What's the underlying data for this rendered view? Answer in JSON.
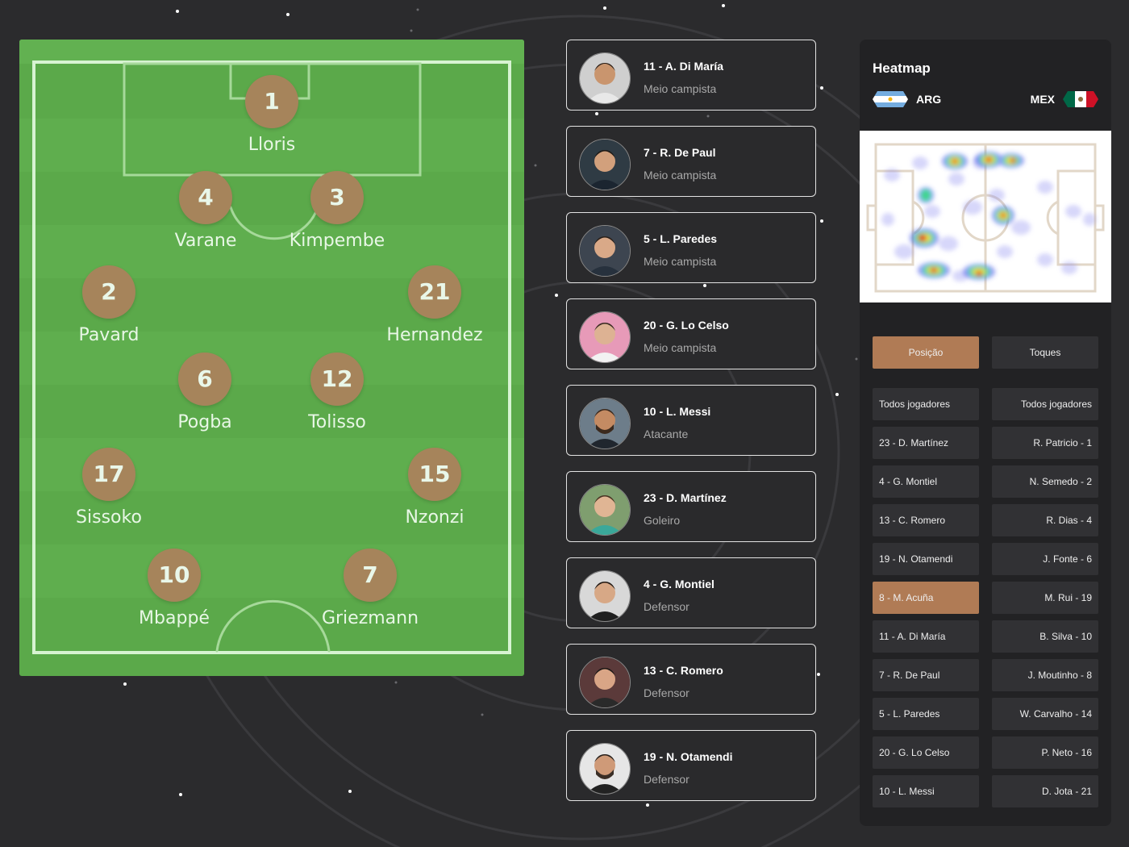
{
  "formation": {
    "players": [
      {
        "number": "1",
        "name": "Lloris"
      },
      {
        "number": "4",
        "name": "Varane"
      },
      {
        "number": "3",
        "name": "Kimpembe"
      },
      {
        "number": "2",
        "name": "Pavard"
      },
      {
        "number": "21",
        "name": "Hernandez"
      },
      {
        "number": "6",
        "name": "Pogba"
      },
      {
        "number": "12",
        "name": "Tolisso"
      },
      {
        "number": "17",
        "name": "Sissoko"
      },
      {
        "number": "15",
        "name": "Nzonzi"
      },
      {
        "number": "10",
        "name": "Mbappé"
      },
      {
        "number": "7",
        "name": "Griezmann"
      }
    ]
  },
  "player_list": [
    {
      "title": "11 - A. Di María",
      "role": "Meio campista"
    },
    {
      "title": "7 - R. De Paul",
      "role": "Meio campista"
    },
    {
      "title": "5 - L. Paredes",
      "role": "Meio campista"
    },
    {
      "title": "20 - G. Lo Celso",
      "role": "Meio campista"
    },
    {
      "title": "10 - L. Messi",
      "role": "Atacante"
    },
    {
      "title": "23 - D. Martínez",
      "role": "Goleiro"
    },
    {
      "title": "4 - G. Montiel",
      "role": "Defensor"
    },
    {
      "title": "13 - C. Romero",
      "role": "Defensor"
    },
    {
      "title": "19 - N. Otamendi",
      "role": "Defensor"
    }
  ],
  "heatmap": {
    "title": "Heatmap",
    "home_team": "ARG",
    "away_team": "MEX",
    "toggle": {
      "position_label": "Posição",
      "touches_label": "Toques",
      "active": "Posição"
    },
    "home_players": [
      "Todos jogadores",
      "23 - D. Martínez",
      "4 - G. Montiel",
      "13 - C. Romero",
      "19 - N. Otamendi",
      "8 - M. Acuña",
      "11 - A. Di María",
      "7 - R. De Paul",
      "5 - L. Paredes",
      "20 - G. Lo Celso",
      "10 - L. Messi"
    ],
    "away_players": [
      "Todos jogadores",
      "R. Patricio - 1",
      "N. Semedo - 2",
      "R. Dias - 4",
      "J. Fonte - 6",
      "M. Rui - 19",
      "B. Silva - 10",
      "J. Moutinho - 8",
      "W. Carvalho - 14",
      "P. Neto - 16",
      "D. Jota - 21"
    ],
    "selected_home_player": "8 - M. Acuña",
    "colors": {
      "accent": "#b07b55",
      "panel": "#222224"
    }
  },
  "colors": {
    "pitch": "#5ba94a",
    "marker": "#a6845b",
    "background": "#2b2b2d"
  }
}
